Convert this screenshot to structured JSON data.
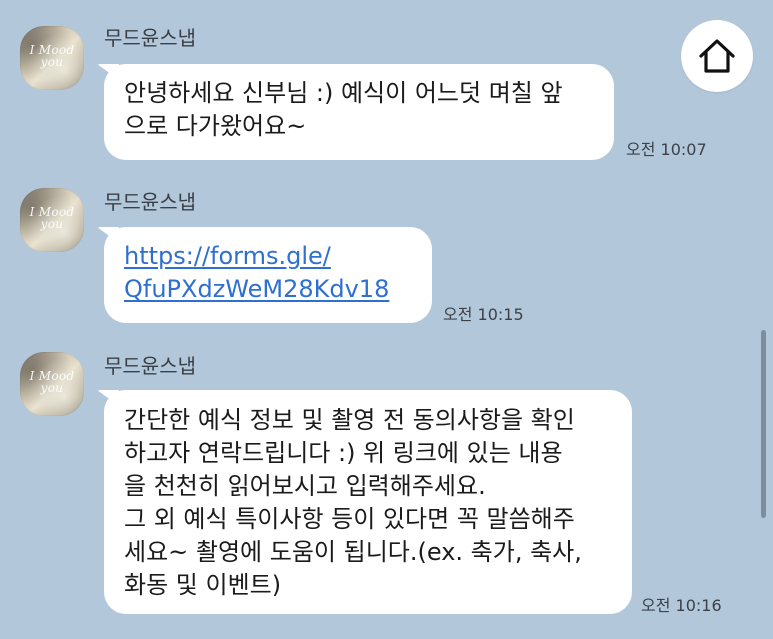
{
  "messages": [
    {
      "sender": "무드윤스냅",
      "avatar_text": [
        "I Mood",
        "you"
      ],
      "lines": [
        "안녕하세요 신부님 :) 예식이 어느덧 며칠 앞",
        "으로 다가왔어요~"
      ],
      "time": "오전 10:07"
    },
    {
      "sender": "무드윤스냅",
      "avatar_text": [
        "I Mood",
        "you"
      ],
      "lines": [
        "https://forms.gle/",
        "QfuPXdzWeM28Kdv18"
      ],
      "time": "오전 10:15"
    },
    {
      "sender": "무드윤스냅",
      "avatar_text": [
        "I Mood",
        "you"
      ],
      "lines": [
        "간단한 예식 정보 및 촬영 전 동의사항을 확인",
        "하고자 연락드립니다 :) 위 링크에 있는 내용",
        "을 천천히 읽어보시고 입력해주세요.",
        "그 외 예식 특이사항 등이 있다면 꼭 말씀해주",
        "세요~ 촬영에 도움이 됩니다.(ex. 축가, 축사,",
        "화동 및 이벤트)"
      ],
      "time": "오전 10:16"
    }
  ],
  "home_button": {
    "icon": "home-icon"
  },
  "colors": {
    "background": "#b2c7da",
    "bubble": "#ffffff",
    "link": "#2f6fd0",
    "text": "#1b1b1b"
  }
}
